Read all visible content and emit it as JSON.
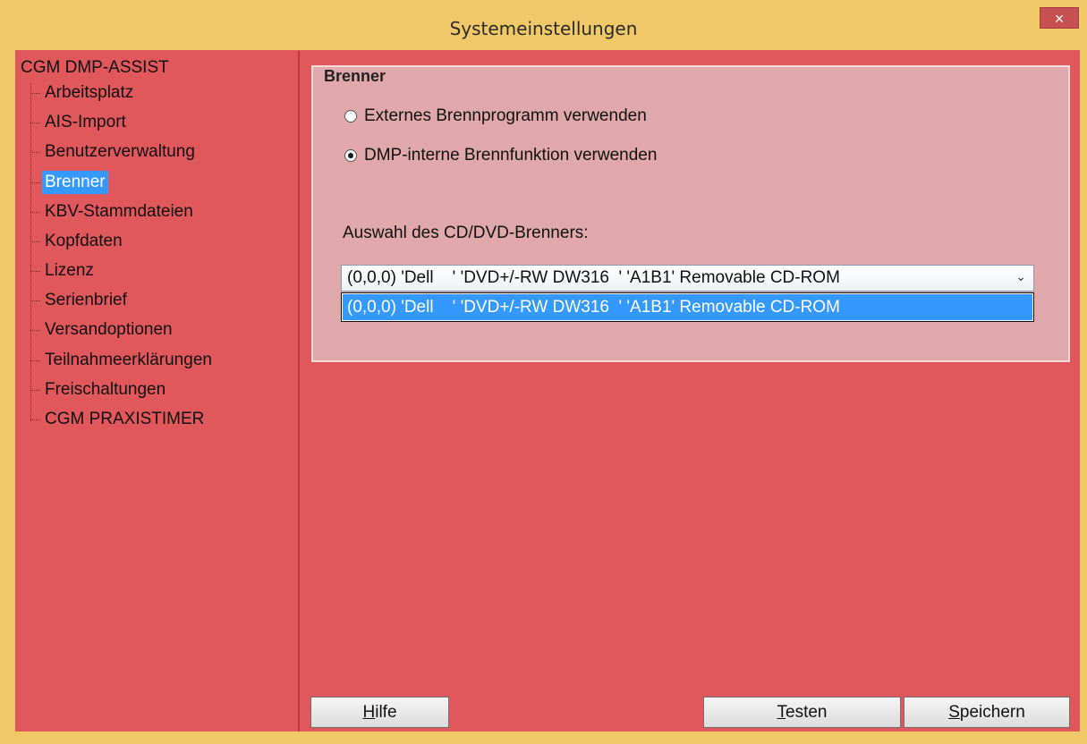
{
  "window": {
    "title": "Systemeinstellungen",
    "close_label": "×"
  },
  "tree": {
    "root": "CGM DMP-ASSIST",
    "items": [
      {
        "label": "Arbeitsplatz",
        "selected": false
      },
      {
        "label": "AIS-Import",
        "selected": false
      },
      {
        "label": "Benutzerverwaltung",
        "selected": false
      },
      {
        "label": "Brenner",
        "selected": true
      },
      {
        "label": "KBV-Stammdateien",
        "selected": false
      },
      {
        "label": "Kopfdaten",
        "selected": false
      },
      {
        "label": "Lizenz",
        "selected": false
      },
      {
        "label": "Serienbrief",
        "selected": false
      },
      {
        "label": "Versandoptionen",
        "selected": false
      },
      {
        "label": "Teilnahmeerklärungen",
        "selected": false
      },
      {
        "label": "Freischaltungen",
        "selected": false
      },
      {
        "label": "CGM PRAXISTIMER",
        "selected": false
      }
    ]
  },
  "brenner": {
    "group_title": "Brenner",
    "radio_external": {
      "label": "Externes Brennprogramm verwenden",
      "checked": false
    },
    "radio_internal": {
      "label": "DMP-interne Brennfunktion verwenden",
      "checked": true
    },
    "select_label": "Auswahl des CD/DVD-Brenners:",
    "select_value": "(0,0,0) 'Dell    ' 'DVD+/-RW DW316  ' 'A1B1' Removable CD-ROM",
    "dropdown_options": [
      "(0,0,0) 'Dell    ' 'DVD+/-RW DW316  ' 'A1B1' Removable CD-ROM"
    ]
  },
  "buttons": {
    "help_mnemonic": "H",
    "help_rest": "ilfe",
    "test_mnemonic": "T",
    "test_rest": "esten",
    "save_mnemonic": "S",
    "save_rest": "peichern"
  },
  "colors": {
    "frame": "#f0c868",
    "client": "#e0575c",
    "groupbox": "#e0a8aa",
    "selection": "#3399ff",
    "close_button": "#c75050"
  }
}
